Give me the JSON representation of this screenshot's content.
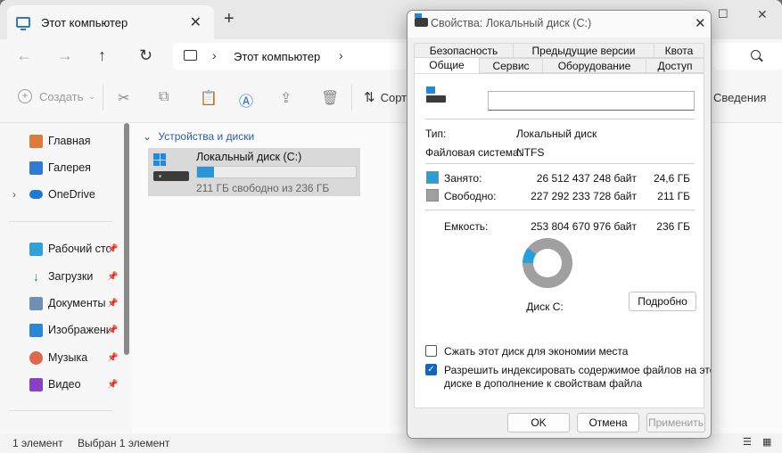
{
  "explorer": {
    "tab_title": "Этот компьютер",
    "close_glyph": "✕",
    "new_tab_glyph": "+",
    "nav": {
      "back": "←",
      "forward": "→",
      "up": "↑",
      "refresh": "↻"
    },
    "breadcrumb": "Этот компьютер",
    "toolbar": {
      "create_label": "Создать",
      "sort_label": "Сорт",
      "details_label": "Сведения"
    },
    "sidebar": {
      "items": [
        {
          "label": "Главная",
          "icon": "home-icon"
        },
        {
          "label": "Галерея",
          "icon": "gallery-icon"
        },
        {
          "label": "OneDrive",
          "icon": "cloud-icon"
        },
        {
          "label": "Рабочий сто.",
          "icon": "desktop-icon"
        },
        {
          "label": "Загрузки",
          "icon": "download-icon"
        },
        {
          "label": "Документы",
          "icon": "documents-icon"
        },
        {
          "label": "Изображени",
          "icon": "pictures-icon"
        },
        {
          "label": "Музыка",
          "icon": "music-icon"
        },
        {
          "label": "Видео",
          "icon": "video-icon"
        }
      ]
    },
    "group_header": "Устройства и диски",
    "drive": {
      "name": "Локальный диск (C:)",
      "free_text": "211 ГБ свободно из 236 ГБ",
      "used_fraction": 0.104
    },
    "status": {
      "count": "1 элемент",
      "selected": "Выбран 1 элемент"
    }
  },
  "dialog": {
    "title": "Свойства: Локальный диск (C:)",
    "tabs_row1": [
      "Безопасность",
      "Предыдущие версии",
      "Квота"
    ],
    "tabs_row2": [
      "Общие",
      "Сервис",
      "Оборудование",
      "Доступ"
    ],
    "active_tab": "Общие",
    "name_value": "",
    "type_label": "Тип:",
    "type_value": "Локальный диск",
    "fs_label": "Файловая система:",
    "fs_value": "NTFS",
    "used": {
      "label": "Занято:",
      "bytes": "26 512 437 248 байт",
      "size": "24,6 ГБ",
      "color": "#26a0da"
    },
    "free": {
      "label": "Свободно:",
      "bytes": "227 292 233 728 байт",
      "size": "211 ГБ",
      "color": "#a0a0a0"
    },
    "capacity": {
      "label": "Емкость:",
      "bytes": "253 804 670 976 байт",
      "size": "236 ГБ"
    },
    "used_fraction": 0.104,
    "disk_label": "Диск C:",
    "details_button": "Подробно",
    "compress_label": "Сжать этот диск для экономии места",
    "compress_checked": false,
    "index_label_1": "Разрешить индексировать содержимое файлов на этом",
    "index_label_2": "диске в дополнение к свойствам файла",
    "index_checked": true,
    "ok": "OK",
    "cancel": "Отмена",
    "apply": "Применить"
  }
}
